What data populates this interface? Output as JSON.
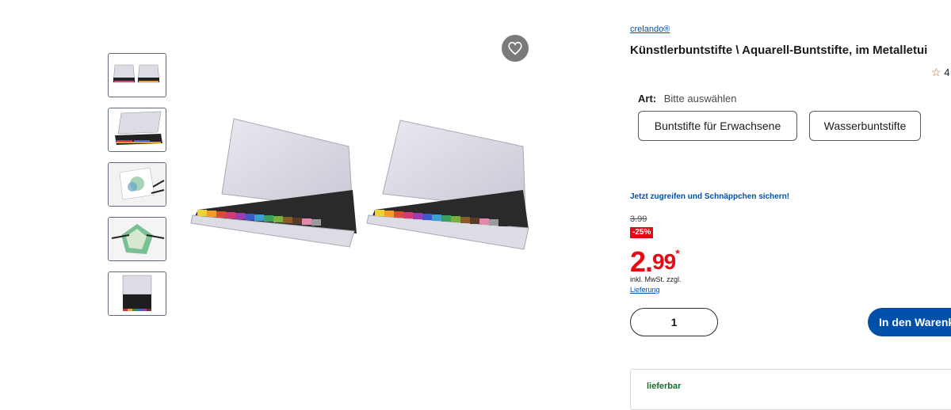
{
  "product": {
    "brand": "crelando®",
    "title": "Künstlerbuntstifte \\ Aquarell-Buntstifte, im Metalletui",
    "rating_value": "4"
  },
  "gallery": {
    "thumbnails": [
      {
        "icon": "two-tins-thumbnail"
      },
      {
        "icon": "single-tin-thumbnail"
      },
      {
        "icon": "drawing-thumbnail"
      },
      {
        "icon": "artwork-thumbnail"
      },
      {
        "icon": "tin-front-thumbnail"
      }
    ],
    "favorite_icon": "heart-icon"
  },
  "variant": {
    "label": "Art:",
    "value": "Bitte auswählen",
    "options": [
      "Buntstifte für Erwachsene",
      "Wasserbuntstifte"
    ]
  },
  "pricing": {
    "promo": "Jetzt zugreifen und Schnäppchen sichern!",
    "old_price": "3.99",
    "discount": "-25%",
    "price_int": "2.",
    "price_dec": "99",
    "price_ast": "*",
    "tax_note": "inkl. MwSt. zzgl.",
    "delivery_link": "Lieferung"
  },
  "cart": {
    "quantity": "1",
    "button_label": "In den Warenkorb"
  },
  "availability": {
    "status": "lieferbar"
  },
  "colors": {
    "accent_blue": "#0050aa",
    "price_red": "#e60a14",
    "stock_green": "#166e2c"
  }
}
